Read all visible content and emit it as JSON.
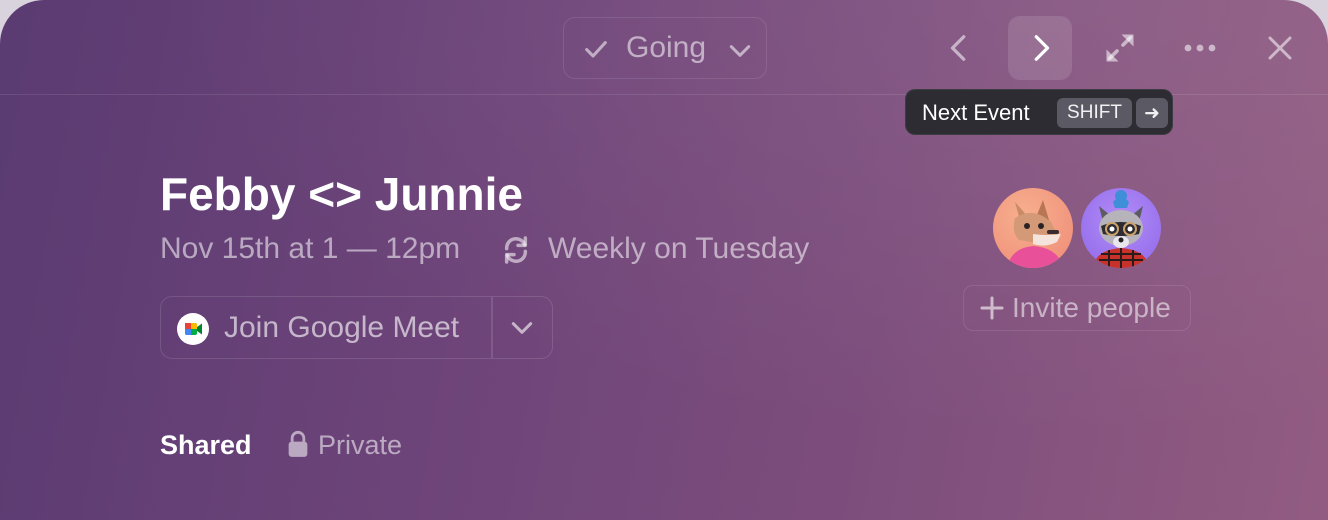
{
  "header": {
    "rsvp": {
      "label": "Going",
      "icon": "check-icon"
    },
    "nav": {
      "prev_icon": "chevron-left-icon",
      "next_icon": "chevron-right-icon",
      "expand_icon": "expand-icon",
      "more_icon": "more-horizontal-icon",
      "close_icon": "close-icon"
    },
    "tooltip": {
      "text": "Next Event",
      "shortcut_modifier": "SHIFT",
      "shortcut_key": "➜"
    }
  },
  "event": {
    "title": "Febby <> Junnie",
    "datetime": "Nov 15th at 1 — 12pm",
    "recurrence": "Weekly on Tuesday",
    "recurrence_icon": "repeat-icon",
    "meeting": {
      "label": "Join Google Meet",
      "icon": "google-meet-icon"
    }
  },
  "attendees": {
    "avatars": [
      {
        "name": "fox-avatar"
      },
      {
        "name": "raccoon-avatar"
      }
    ],
    "invite_label": "Invite people"
  },
  "visibility": {
    "shared_label": "Shared",
    "private_label": "Private",
    "private_icon": "lock-icon"
  },
  "colors": {
    "background_start": "#5a3b72",
    "background_end": "#925c82",
    "tooltip_bg": "#2e2c33",
    "kbd_bg": "#5b5963"
  }
}
